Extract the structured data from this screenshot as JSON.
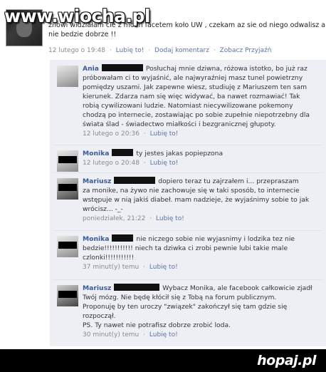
{
  "watermark_top": "www.wiocha.pl",
  "status": {
    "text_lines": [
      "żnowi widziałam cie z moim facetem koło UW , czekam az sie od niego odwalisz albo",
      "nie bedzie dobrze !!"
    ],
    "timestamp": "12 lutego o 19:48",
    "like": "Lubię to!",
    "add_comment": "Dodaj komentarz",
    "view_friendship": "Zobacz Przyjaźń"
  },
  "comments": [
    {
      "author": "Ania",
      "lines": [
        "Posłuchaj mnie dziwna, różowa istotko, bo już raz",
        "próbowałam ci to wyjaśnić, ale najwyraźniej masz tunel powietrzny",
        "pomiędzy uszami. Jak zapewne wiesz, studiuję z Mariuszem ten sam",
        "kierunek. Zdarza nam się więc widywać, ba nawet rozmawiać! Tak",
        "robią cywilizowani ludzie. Natomiast niecywilizowane pokemony",
        "chodzą po internecie, zostawiając po sobie zupełnie niepotrzebny dla",
        "świata ślad - świadectwo miałkości i bezgranicznej głupoty."
      ],
      "timestamp": "12 lutego o 20:36",
      "like": "Lubię to!"
    },
    {
      "author": "Monika",
      "lines": [
        "ty jestes jakas popiepzona"
      ],
      "timestamp": "12 lutego o 20:48",
      "like": "Lubię to!"
    },
    {
      "author": "Mariusz",
      "lines": [
        "dopiero teraz tu zajrzałem i... przepraszam",
        "za monike, na żywo nie zachowuje się w taki sposób, to internecie",
        "wstępuje w nią jakiś diabeł. mam nadzieje, że wyjaśnimy sobie to jak",
        "wrócisz... -_-"
      ],
      "timestamp": "poniedziałek, 21:22",
      "like": "Lubię to!"
    },
    {
      "author": "Monika",
      "lines": [
        "nie niczego sobie nie wyjasnimy i lodzika tez nie",
        "bedzie!!!!!!!!!!! niech ta dziwka ci zrobi pewnie lubi takie male",
        "czlonki!!!!!!!!!!!"
      ],
      "timestamp": "37 minut(y) temu",
      "like": "Lubię to!"
    },
    {
      "author": "Mariusz",
      "lines": [
        "Wybacz Monika, ale facebook całkowicie zjadł",
        "Twój mózg. Nie będę kłócił się z Tobą na forum publicznym.",
        "Proponuję by ten uroczy \"związek\" zakończył się tam gdzie się",
        "rozpoczął.",
        "PS. Ty nawet nie potrafisz dobrze zrobić loda."
      ],
      "timestamp": "30 minut(y) temu",
      "like": "Lubię to!"
    }
  ],
  "bottom_logo": "hopaj.pl",
  "colors": {
    "link": "#3b5998",
    "comments_bg": "#edeff4",
    "meta": "#8a8a8a"
  }
}
